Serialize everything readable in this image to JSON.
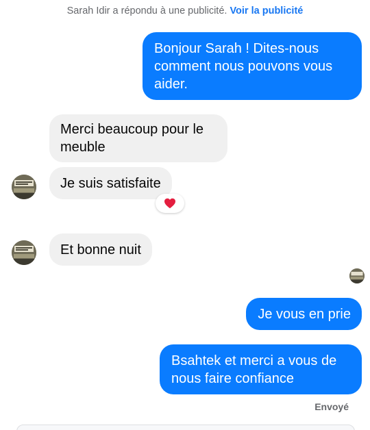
{
  "notice": {
    "text": "Sarah Idir a répondu à une publicité.",
    "link": "Voir la publicité"
  },
  "messages": [
    {
      "from": "page",
      "text": "Bonjour Sarah ! Dites-nous comment nous pouvons vous aider."
    },
    {
      "from": "user",
      "text": "Merci beaucoup pour le meuble"
    },
    {
      "from": "user",
      "text": "Je suis satisfaite",
      "reaction": "❤️"
    },
    {
      "from": "user",
      "text": "Et bonne nuit"
    },
    {
      "from": "page",
      "text": "Je vous en prie"
    },
    {
      "from": "page",
      "text": "Bsahtek et merci a vous de nous faire confiance"
    }
  ],
  "status": "Envoyé",
  "colors": {
    "outgoing_bubble": "#0a7cff",
    "incoming_bubble": "#f0f0f0",
    "link": "#1877f2",
    "reaction_heart": "#e41e3f"
  }
}
